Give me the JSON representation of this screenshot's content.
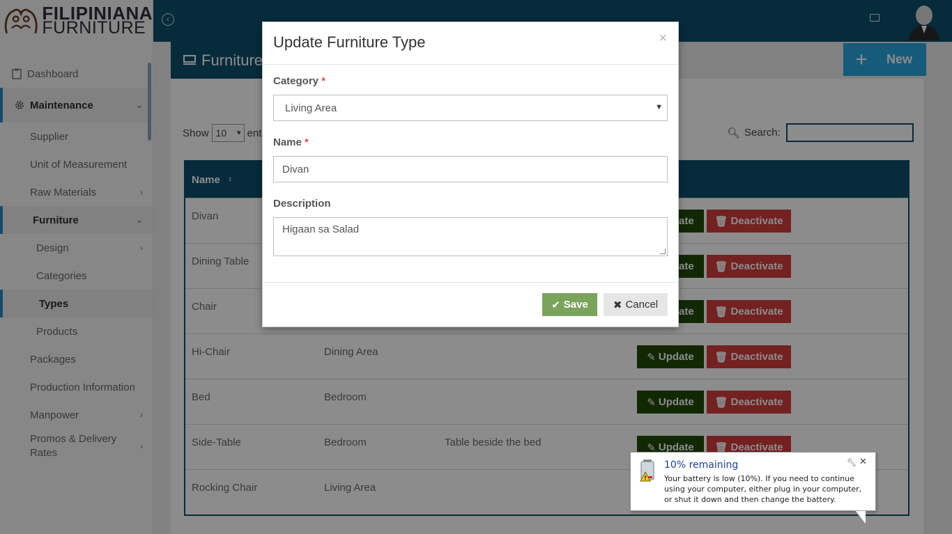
{
  "brand": {
    "line1": "FILIPINIANA",
    "line2": "FURNITURE"
  },
  "sidebar": {
    "items": [
      {
        "label": "Dashboard"
      },
      {
        "label": "Maintenance"
      },
      {
        "label": "Supplier"
      },
      {
        "label": "Unit of Measurement"
      },
      {
        "label": "Raw Materials"
      },
      {
        "label": "Furniture"
      },
      {
        "label": "Design"
      },
      {
        "label": "Categories"
      },
      {
        "label": "Types"
      },
      {
        "label": "Products"
      },
      {
        "label": "Packages"
      },
      {
        "label": "Production Information"
      },
      {
        "label": "Manpower"
      },
      {
        "label": "Promos & Delivery Rates"
      }
    ]
  },
  "page": {
    "title": "Furniture",
    "new_label": "New",
    "show_label": "Show",
    "show_value": "10",
    "entries_label": "ent",
    "search_label": "Search:",
    "table_header_name": "Name",
    "rows": [
      {
        "name": "Divan",
        "category": "",
        "description": ""
      },
      {
        "name": "Dining Table",
        "category": "",
        "description": ""
      },
      {
        "name": "Chair",
        "category": "",
        "description": ""
      },
      {
        "name": "Hi-Chair",
        "category": "Dining Area",
        "description": ""
      },
      {
        "name": "Bed",
        "category": "Bedroom",
        "description": ""
      },
      {
        "name": "Side-Table",
        "category": "Bedroom",
        "description": "Table beside the bed"
      },
      {
        "name": "Rocking Chair",
        "category": "Living Area",
        "description": ""
      }
    ],
    "update_label": "Update",
    "deactivate_label": "Deactivate"
  },
  "modal": {
    "title": "Update Furniture Type",
    "close": "×",
    "category_label": "Category",
    "category_value": "Living Area",
    "name_label": "Name",
    "name_value": "Divan",
    "description_label": "Description",
    "description_value": "Higaan sa Salad",
    "required_mark": "*",
    "save_label": "Save",
    "cancel_label": "Cancel"
  },
  "balloon": {
    "title": "10% remaining",
    "text": "Your battery is low (10%). If you need to continue using your computer, either plug in your computer, or shut it down and then change the battery."
  },
  "colors": {
    "topbar": "#0b4f6c",
    "accent": "#2f86c5",
    "save": "#7aa35c",
    "update": "#1f4a06",
    "deactivate": "#d23d3d"
  }
}
